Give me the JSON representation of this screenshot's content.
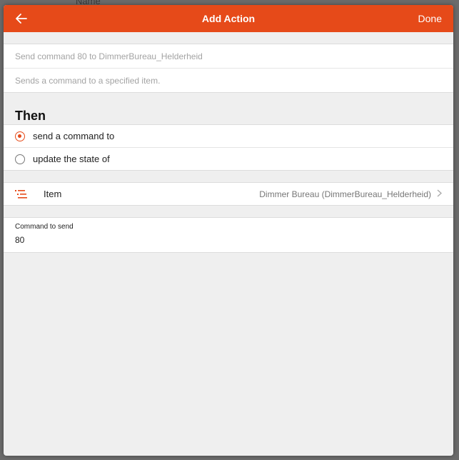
{
  "backdrop": {
    "text": "Name"
  },
  "navbar": {
    "title": "Add Action",
    "done_label": "Done",
    "back_icon": "arrow-left-icon"
  },
  "details": {
    "label_placeholder": "Send command 80 to DimmerBureau_Helderheid",
    "description_placeholder": "Sends a command to a specified item."
  },
  "then": {
    "title": "Then",
    "options": [
      {
        "label": "send a command to",
        "checked": true
      },
      {
        "label": "update the state of",
        "checked": false
      }
    ]
  },
  "item": {
    "label": "Item",
    "value": "Dimmer Bureau (DimmerBureau_Helderheid)",
    "icon": "list-icon"
  },
  "command": {
    "label": "Command to send",
    "value": "80"
  },
  "colors": {
    "accent": "#e64a19"
  }
}
